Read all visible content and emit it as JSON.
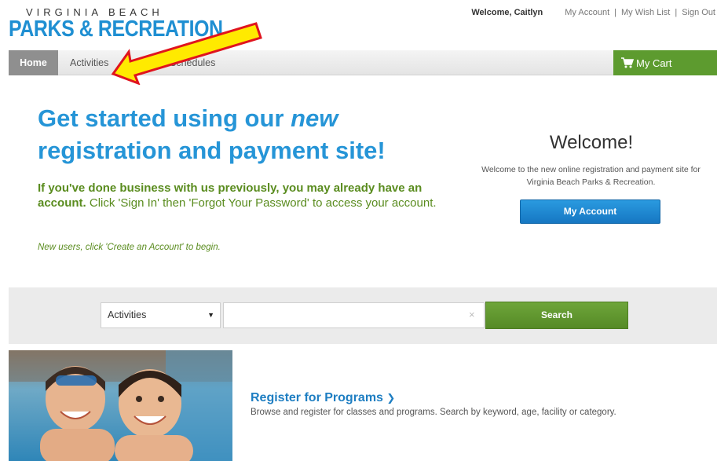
{
  "header": {
    "logo_top": "VIRGINIA BEACH",
    "logo_main": "PARKS & RECREATION",
    "welcome": "Welcome, Caitlyn",
    "links": [
      "My Account",
      "My Wish List",
      "Sign Out"
    ],
    "separator": "|"
  },
  "nav": {
    "tabs": [
      "Home",
      "Activities",
      "Schedules"
    ],
    "cart_label": "My Cart"
  },
  "hero": {
    "title_line1_a": "Get started using our ",
    "title_line1_em": "new",
    "title_line2": "registration and payment site!",
    "bold_text": "If you've done business with us previously, you may already have an account.",
    "rest_text": " Click 'Sign In' then 'Forgot Your Password' to access your account.",
    "new_users": "New users, click 'Create an Account' to begin."
  },
  "welcome_panel": {
    "heading": "Welcome!",
    "text": "Welcome to the new online registration and payment site for Virginia Beach Parks & Recreation.",
    "button": "My Account"
  },
  "search": {
    "category_selected": "Activities",
    "input_value": "",
    "input_placeholder": "",
    "clear": "×",
    "button": "Search"
  },
  "program": {
    "title": "Register for Programs",
    "chevron": "❯",
    "description": "Browse and register for classes and programs. Search by keyword, age, facility or category."
  },
  "colors": {
    "brand_blue": "#2695d7",
    "brand_green": "#5a8c1f",
    "cart_green": "#5d9b2f",
    "arrow_yellow": "#ffea00",
    "arrow_red": "#e0141e"
  },
  "icons": {
    "cart": "cart-icon",
    "caret": "caret-down-icon",
    "clear": "clear-icon",
    "arrow": "annotation-arrow"
  }
}
